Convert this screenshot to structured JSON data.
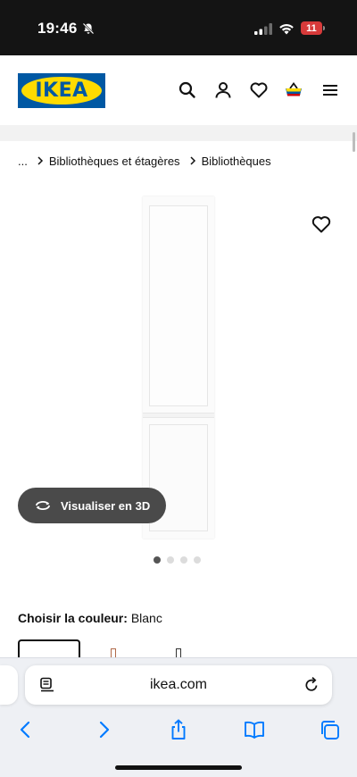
{
  "status_bar": {
    "time": "19:46",
    "battery_level": "11",
    "battery_color": "#d73a3a"
  },
  "header": {
    "logo_text": "IKEA",
    "brand_blue": "#0058a3",
    "brand_yellow": "#ffdb00",
    "icons": [
      "search-icon",
      "user-icon",
      "heart-icon",
      "basket-icon",
      "menu-icon"
    ]
  },
  "breadcrumb": {
    "items": [
      "...",
      "Bibliothèques et étagères",
      "Bibliothèques"
    ]
  },
  "gallery": {
    "view_3d_label": "Visualiser en 3D",
    "image_count": 4,
    "active_index": 0
  },
  "color_chooser": {
    "title": "Choisir la couleur:",
    "selected_value": "Blanc"
  },
  "safari": {
    "url": "ikea.com",
    "toolbar_icons": [
      "back-icon",
      "forward-icon",
      "share-icon",
      "bookmarks-icon",
      "tabs-icon"
    ],
    "accent": "#007aff"
  }
}
